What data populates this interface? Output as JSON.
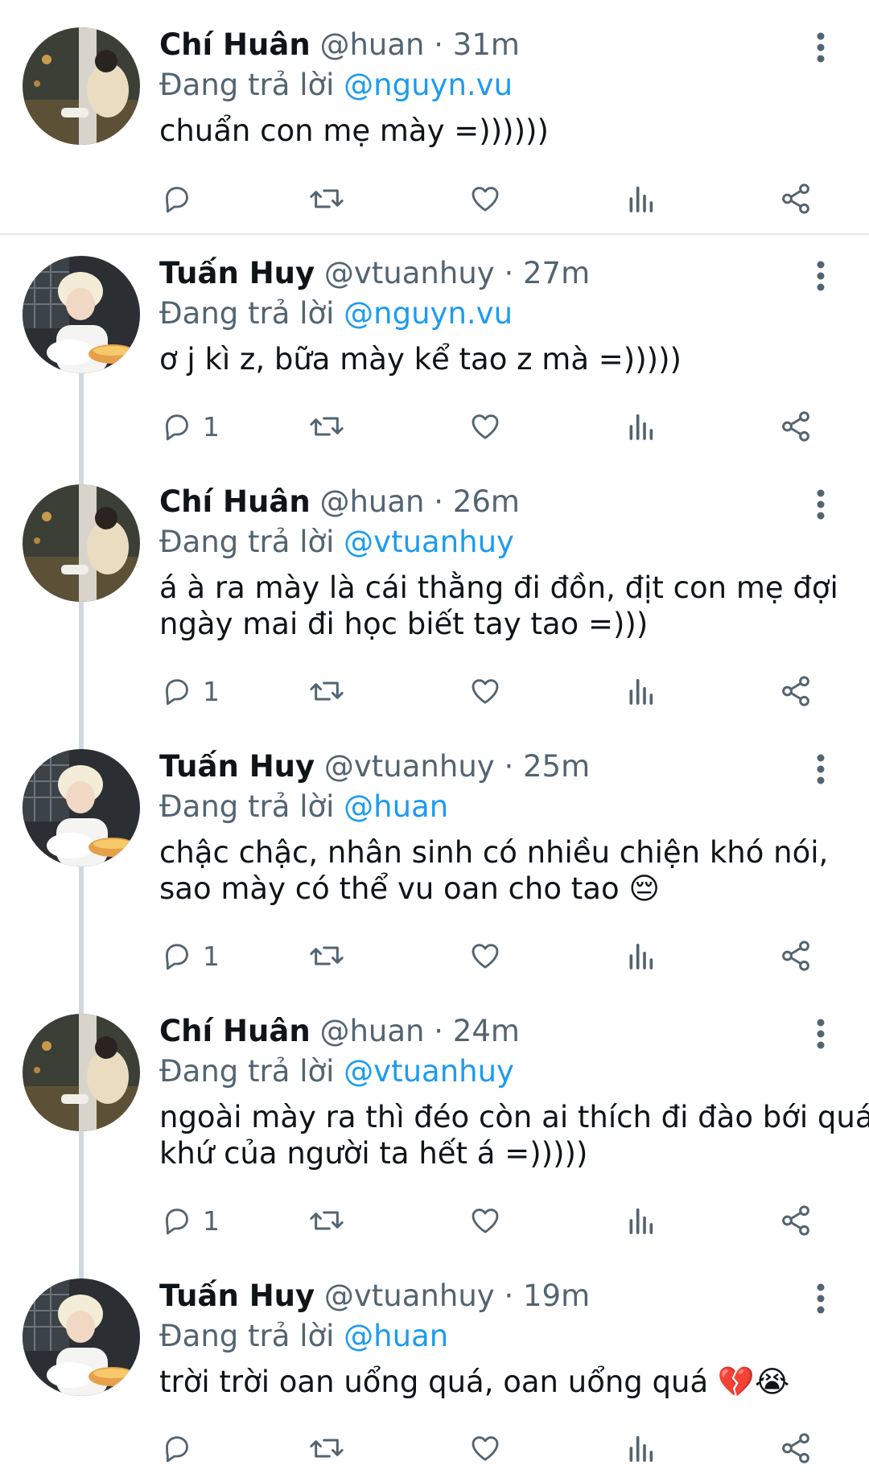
{
  "reply_prefix": "Đang trả lời",
  "colors": {
    "mention": "#1d9bf0",
    "secondary_text": "#536471",
    "thread_line": "#cfd9de"
  },
  "icons": {
    "reply": "reply-icon",
    "retweet": "retweet-icon",
    "like": "like-icon",
    "views": "views-icon",
    "share": "share-icon",
    "more": "more-options-icon"
  },
  "tweets": [
    {
      "name": "Chí Huân",
      "handle": "@huan",
      "separator": "·",
      "time": "31m",
      "reply_to": "@nguyn.vu",
      "text_lines": [
        "chuẩn con mẹ mày =))))))"
      ],
      "reply_count": ""
    },
    {
      "name": "Tuấn Huy",
      "handle": "@vtuanhuy",
      "separator": "·",
      "time": "27m",
      "reply_to": "@nguyn.vu",
      "text_lines": [
        "ơ j kì z, bữa mày kể tao z mà =)))))"
      ],
      "reply_count": "1"
    },
    {
      "name": "Chí Huân",
      "handle": "@huan",
      "separator": "·",
      "time": "26m",
      "reply_to": "@vtuanhuy",
      "text_lines": [
        "á à ra mày là cái thằng đi đồn, địt con mẹ đợi",
        "ngày mai đi học biết tay tao =)))"
      ],
      "reply_count": "1"
    },
    {
      "name": "Tuấn Huy",
      "handle": "@vtuanhuy",
      "separator": "·",
      "time": "25m",
      "reply_to": "@huan",
      "text_lines": [
        "chậc chậc, nhân sinh có nhiều chiện khó nói,",
        "sao mày có thể vu oan cho tao 😔"
      ],
      "reply_count": "1"
    },
    {
      "name": "Chí Huân",
      "handle": "@huan",
      "separator": "·",
      "time": "24m",
      "reply_to": "@vtuanhuy",
      "text_lines": [
        "ngoài mày ra thì đéo còn ai thích đi đào bới quá",
        "khứ của người ta hết á =)))))"
      ],
      "reply_count": "1"
    },
    {
      "name": "Tuấn Huy",
      "handle": "@vtuanhuy",
      "separator": "·",
      "time": "19m",
      "reply_to": "@huan",
      "text_lines": [
        "trời trời oan uổng quá, oan uổng quá 💔😭"
      ],
      "reply_count": ""
    }
  ]
}
